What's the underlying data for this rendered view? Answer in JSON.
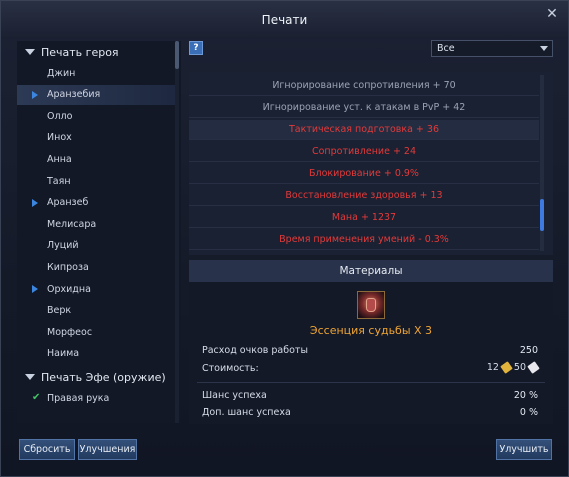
{
  "window": {
    "title": "Печати",
    "close_icon": "close-icon"
  },
  "left": {
    "group1": "Печать героя",
    "heroes": [
      {
        "label": "Джин",
        "marker": ""
      },
      {
        "label": "Аранзебия",
        "marker": "play"
      },
      {
        "label": "Олло",
        "marker": ""
      },
      {
        "label": "Инох",
        "marker": ""
      },
      {
        "label": "Анна",
        "marker": ""
      },
      {
        "label": "Таян",
        "marker": ""
      },
      {
        "label": "Аранзеб",
        "marker": "play"
      },
      {
        "label": "Мелисара",
        "marker": ""
      },
      {
        "label": "Луций",
        "marker": ""
      },
      {
        "label": "Кипроза",
        "marker": ""
      },
      {
        "label": "Орхидна",
        "marker": "play"
      },
      {
        "label": "Верк",
        "marker": ""
      },
      {
        "label": "Морфеос",
        "marker": ""
      },
      {
        "label": "Наима",
        "marker": ""
      }
    ],
    "selected_hero": "Аранзебия",
    "group2": "Печать Эфе (оружие)",
    "group2_item": "Правая рука"
  },
  "filter": {
    "help": "?",
    "value": "Все"
  },
  "stats": [
    {
      "text": "Игнорирование сопротивления + 70",
      "color": "grey"
    },
    {
      "text": "Игнорирование уст. к атакам в PvP + 42",
      "color": "grey"
    },
    {
      "text": "Тактическая подготовка + 36",
      "color": "red"
    },
    {
      "text": "Сопротивление + 24",
      "color": "red"
    },
    {
      "text": "Блокирование + 0.9%",
      "color": "red"
    },
    {
      "text": "Восстановление здоровья + 13",
      "color": "red"
    },
    {
      "text": "Мана + 1237",
      "color": "red"
    },
    {
      "text": "Время применения умений - 0.3%",
      "color": "red"
    }
  ],
  "materials": {
    "header": "Материалы",
    "item_name": "Эссенция судьбы X 3",
    "work_points_label": "Расход очков работы",
    "work_points_value": "250",
    "cost_label": "Стоимость:",
    "cost_gold": "12",
    "cost_silver": "50",
    "success_label": "Шанс успеха",
    "success_value": "20 %",
    "extra_success_label": "Доп. шанс успеха",
    "extra_success_value": "0 %"
  },
  "buttons": {
    "reset": "Сбросить",
    "upgrades": "Улучшения",
    "upgrade": "Улучшить"
  },
  "colors": {
    "accent": "#3d86e0",
    "stat_red": "#e23a3a",
    "item_orange": "#f0a533"
  }
}
